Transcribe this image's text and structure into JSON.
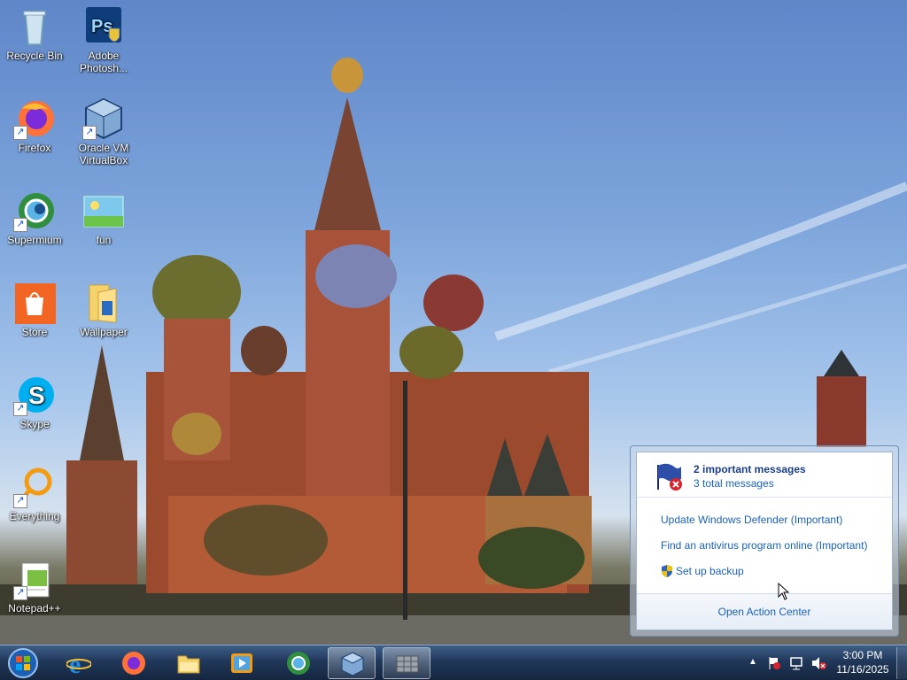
{
  "desktop": {
    "icons": [
      {
        "label_line1": "Recycle Bin",
        "label_line2": ""
      },
      {
        "label_line1": "Adobe",
        "label_line2": "Photosh..."
      },
      {
        "label_line1": "Firefox",
        "label_line2": ""
      },
      {
        "label_line1": "Oracle VM",
        "label_line2": "VirtualBox"
      },
      {
        "label_line1": "Supermium",
        "label_line2": ""
      },
      {
        "label_line1": "fun",
        "label_line2": ""
      },
      {
        "label_line1": "Store",
        "label_line2": ""
      },
      {
        "label_line1": "Wallpaper",
        "label_line2": ""
      },
      {
        "label_line1": "Skype",
        "label_line2": ""
      },
      {
        "label_line1": "Everything",
        "label_line2": ""
      },
      {
        "label_line1": "Notepad++",
        "label_line2": ""
      }
    ]
  },
  "action_center": {
    "title": "2 important messages",
    "subtitle": "3 total messages",
    "items": [
      "Update Windows Defender (Important)",
      "Find an antivirus program online (Important)",
      "Set up backup"
    ],
    "footer": "Open Action Center"
  },
  "taskbar": {
    "pinned": [
      "start-orb",
      "internet-explorer",
      "firefox",
      "file-explorer",
      "media-player",
      "supermium",
      "virtualbox",
      "taskbar-app"
    ],
    "clock_time": "3:00 PM",
    "clock_date": "11/16/2025"
  },
  "colors": {
    "taskbar": "#1f3454",
    "link": "#1a62b8"
  }
}
